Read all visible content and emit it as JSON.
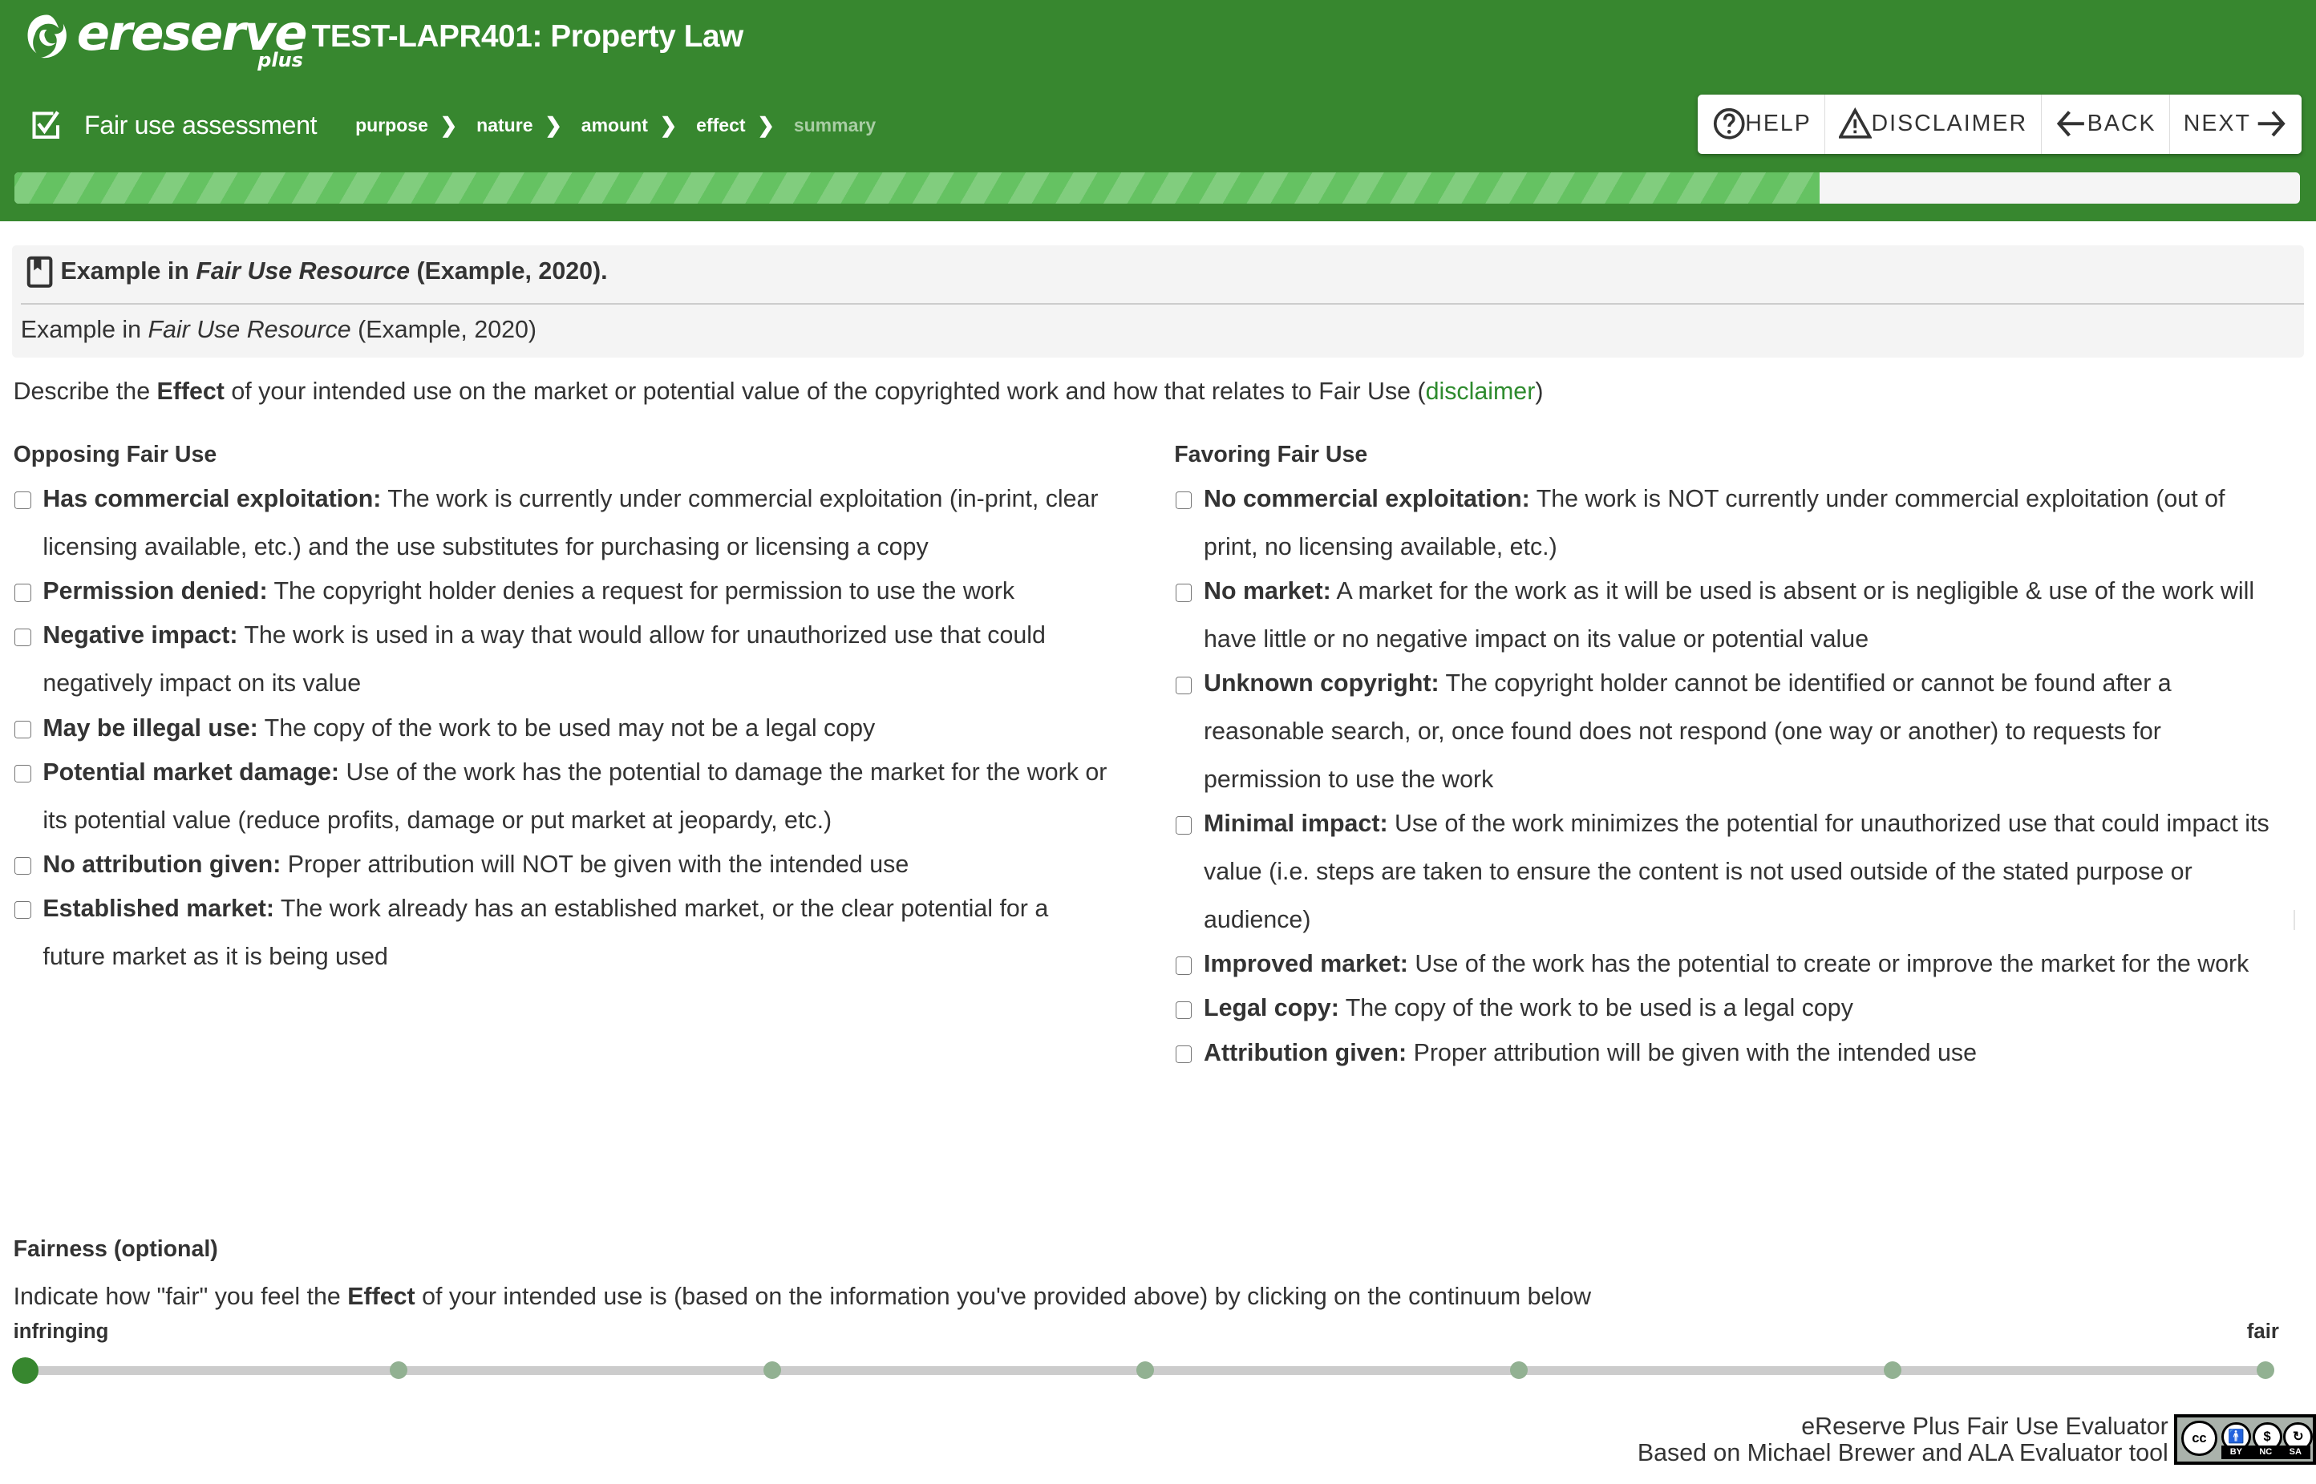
{
  "brand": {
    "logo_text": "ereserve",
    "logo_sub": "plus",
    "course_title": "TEST-LAPR401: Property Law",
    "primary_color": "#37872f"
  },
  "assessment": {
    "title": "Fair use assessment",
    "breadcrumb": [
      {
        "label": "purpose",
        "active": true
      },
      {
        "label": "nature",
        "active": true
      },
      {
        "label": "amount",
        "active": true
      },
      {
        "label": "effect",
        "active": true
      },
      {
        "label": "summary",
        "active": false
      }
    ],
    "progress_percent": 79
  },
  "nav": {
    "help": "HELP",
    "disclaimer": "DISCLAIMER",
    "back": "BACK",
    "next": "NEXT"
  },
  "citation": {
    "head_prefix": "Example in ",
    "head_title": "Fair Use Resource",
    "head_suffix": " (Example, 2020).",
    "body_prefix": "Example in ",
    "body_title": "Fair Use Resource",
    "body_suffix": " (Example, 2020)"
  },
  "describe": {
    "prefix": "Describe the ",
    "bold": "Effect",
    "suffix": " of your intended use on the market or potential value of the copyrighted work and how that relates to Fair Use (",
    "link": "disclaimer",
    "end": ")"
  },
  "opposing": {
    "title": "Opposing Fair Use",
    "items": [
      {
        "label": "Has commercial exploitation:",
        "text": " The work is currently under commercial exploitation (in-print, clear licensing available, etc.) and the use substitutes for purchasing or licensing a copy",
        "checked": false
      },
      {
        "label": "Permission denied:",
        "text": " The copyright holder denies a request for permission to use the work",
        "checked": false
      },
      {
        "label": "Negative impact:",
        "text": " The work is used in a way that would allow for unauthorized use that could negatively impact on its value",
        "checked": false
      },
      {
        "label": "May be illegal use:",
        "text": " The copy of the work to be used may not be a legal copy",
        "checked": false
      },
      {
        "label": "Potential market damage:",
        "text": " Use of the work has the potential to damage the market for the work or its potential value (reduce profits, damage or put market at jeopardy, etc.)",
        "checked": false
      },
      {
        "label": "No attribution given:",
        "text": " Proper attribution will NOT be given with the intended use",
        "checked": false
      },
      {
        "label": "Established market:",
        "text": " The work already has an established market, or the clear potential for a future market as it is being used",
        "checked": false
      }
    ]
  },
  "favoring": {
    "title": "Favoring Fair Use",
    "items": [
      {
        "label": "No commercial exploitation:",
        "text": " The work is NOT currently under commercial exploitation (out of print, no licensing available, etc.)",
        "checked": false
      },
      {
        "label": "No market:",
        "text": " A market for the work as it will be used is absent or is negligible & use of the work will have little or no negative impact on its value or potential value",
        "checked": false
      },
      {
        "label": "Unknown copyright:",
        "text": " The copyright holder cannot be identified or cannot be found after a reasonable search, or, once found does not respond (one way or another) to requests for permission to use the work",
        "checked": false
      },
      {
        "label": "Minimal impact:",
        "text": " Use of the work minimizes the potential for unauthorized use that could impact its value (i.e. steps are taken to ensure the content is not used outside of the stated purpose or audience)",
        "checked": false
      },
      {
        "label": "Improved market:",
        "text": " Use of the work has the potential to create or improve the market for the work",
        "checked": false
      },
      {
        "label": "Legal copy:",
        "text": " The copy of the work to be used is a legal copy",
        "checked": false
      },
      {
        "label": "Attribution given:",
        "text": " Proper attribution will be given with the intended use",
        "checked": false
      }
    ]
  },
  "fairness": {
    "title": "Fairness (optional)",
    "desc_prefix": "Indicate how \"fair\" you feel the ",
    "desc_bold": "Effect",
    "desc_suffix": " of your intended use is (based on the information you've provided above) by clicking on the continuum below",
    "left_label": "infringing",
    "right_label": "fair",
    "stops": 7,
    "selected_index": 0
  },
  "footer": {
    "line1": "eReserve Plus Fair Use Evaluator",
    "line2": "Based on Michael Brewer and ALA Evaluator tool",
    "license_badge": [
      "BY",
      "NC",
      "SA"
    ]
  }
}
